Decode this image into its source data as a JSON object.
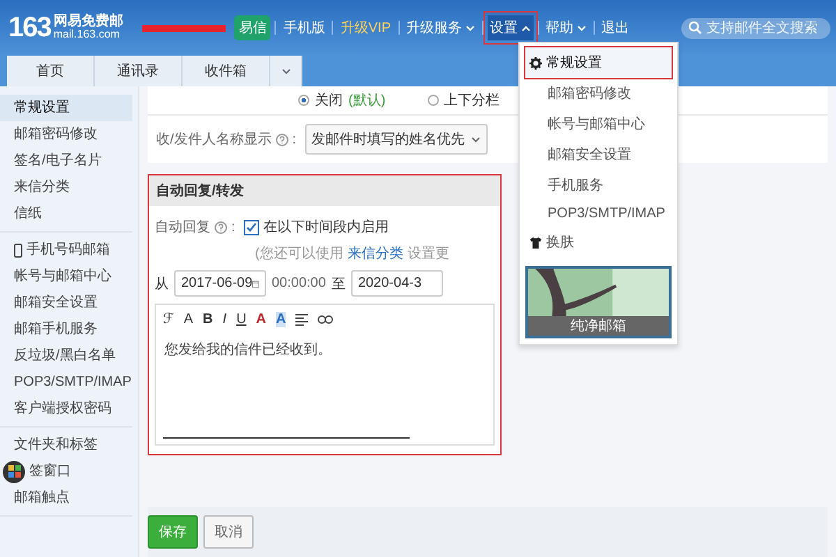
{
  "header": {
    "logo": {
      "number": "163",
      "name": "网易免费邮",
      "domain": "mail.163.com"
    },
    "links": [
      {
        "kind": "badge",
        "label": "易信"
      },
      {
        "kind": "link",
        "label": "手机版"
      },
      {
        "kind": "vip",
        "label": "升级VIP"
      },
      {
        "kind": "menu",
        "label": "升级服务",
        "expanded": false
      },
      {
        "kind": "menu",
        "label": "设置",
        "expanded": true
      },
      {
        "kind": "menu",
        "label": "帮助",
        "expanded": false
      },
      {
        "kind": "link",
        "label": "退出"
      }
    ],
    "search": {
      "placeholder": "支持邮件全文搜索"
    }
  },
  "tabs": [
    {
      "label": "首页"
    },
    {
      "label": "通讯录"
    },
    {
      "label": "收件箱"
    }
  ],
  "sidebar": {
    "groups": [
      [
        {
          "label": "常规设置",
          "selected": true
        },
        {
          "label": "邮箱密码修改",
          "selected": false
        },
        {
          "label": "签名/电子名片",
          "selected": false
        },
        {
          "label": "来信分类",
          "selected": false
        },
        {
          "label": "信纸",
          "selected": false
        }
      ],
      [
        {
          "label": "手机号码邮箱",
          "selected": false,
          "kind": "phone"
        },
        {
          "label": "帐号与邮箱中心",
          "selected": false
        },
        {
          "label": "邮箱安全设置",
          "selected": false
        },
        {
          "label": "邮箱手机服务",
          "selected": false
        },
        {
          "label": "反垃圾/黑白名单",
          "selected": false
        },
        {
          "label": "POP3/SMTP/IMAP",
          "selected": false
        },
        {
          "label": "客户端授权密码",
          "selected": false
        }
      ],
      [
        {
          "label": "文件夹和标签",
          "selected": false
        },
        {
          "label": "签窗口",
          "selected": false,
          "kind": "apps"
        },
        {
          "label": "邮箱触点",
          "selected": false
        }
      ]
    ]
  },
  "layout_options": [
    {
      "label": "关闭",
      "note": "(默认)",
      "selected": true
    },
    {
      "label": "上下分栏",
      "selected": false
    }
  ],
  "name_display": {
    "label": "收/发件人名称显示",
    "colon": ":",
    "value": "发邮件时填写的姓名优先"
  },
  "auto_reply": {
    "title": "自动回复/转发",
    "label": "自动回复",
    "colon": ":",
    "enable": {
      "label": "在以下时间段内启用",
      "checked": true
    },
    "hint": "(您还可以使用",
    "hint_link": "来信分类",
    "hint_tail": "设置更",
    "from_label": "从",
    "from_date": "2017-06-09",
    "from_time": "00:00:00",
    "to_label": "至",
    "to_date": "2020-04-3",
    "toolbar": [
      {
        "kind": "font",
        "label": "ℱ"
      },
      {
        "kind": "size",
        "label": "A"
      },
      {
        "kind": "bold",
        "label": "B"
      },
      {
        "kind": "italic",
        "label": "I"
      },
      {
        "kind": "underline",
        "label": "U"
      },
      {
        "kind": "color",
        "label": "A"
      },
      {
        "kind": "highlight",
        "label": "A"
      }
    ],
    "body": "您发给我的信件已经收到。"
  },
  "buttons": [
    {
      "kind": "primary",
      "label": "保存"
    },
    {
      "kind": "secondary",
      "label": "取消"
    }
  ],
  "settings_menu": {
    "items": [
      {
        "label": "常规设置",
        "kind": "gear",
        "selected": true
      },
      {
        "label": "邮箱密码修改",
        "kind": "plain",
        "selected": false
      },
      {
        "label": "帐号与邮箱中心",
        "kind": "plain",
        "selected": false
      },
      {
        "label": "邮箱安全设置",
        "kind": "plain",
        "selected": false
      },
      {
        "label": "手机服务",
        "kind": "plain",
        "selected": false
      },
      {
        "label": "POP3/SMTP/IMAP",
        "kind": "plain",
        "selected": false
      },
      {
        "label": "换肤",
        "kind": "shirt",
        "selected": false
      }
    ],
    "skin_caption": "纯净邮箱"
  }
}
